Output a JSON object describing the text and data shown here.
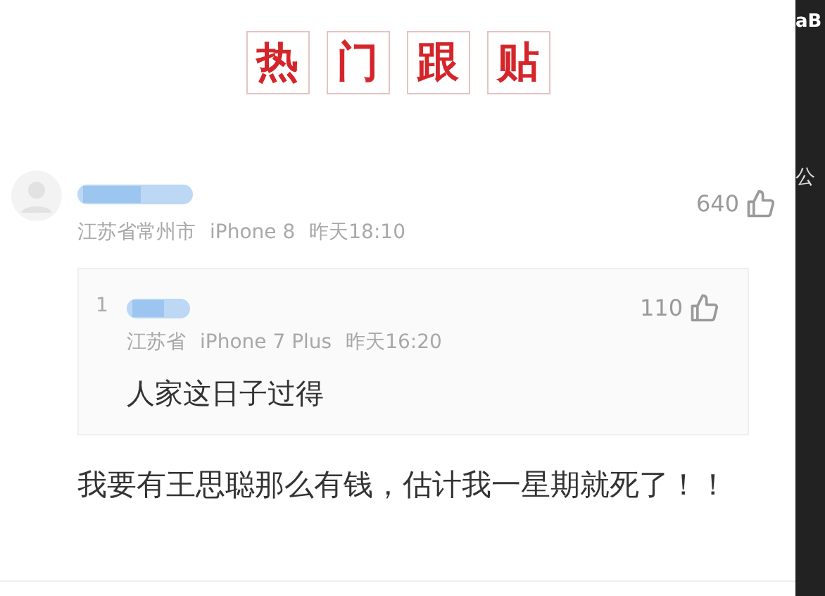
{
  "header": {
    "characters": [
      "热",
      "门",
      "跟",
      "贴"
    ]
  },
  "comment": {
    "location": "江苏省常州市",
    "device": "iPhone 8",
    "time": "昨天18:10",
    "likes": "640",
    "reply": {
      "floor": "1",
      "location": "江苏省",
      "device": "iPhone 7 Plus",
      "time": "昨天16:20",
      "likes": "110",
      "text": "人家这日子过得"
    },
    "text": "我要有王思聪那么有钱，估计我一星期就死了！！"
  },
  "side_panel": {
    "texts": [
      "aB",
      "公"
    ]
  }
}
